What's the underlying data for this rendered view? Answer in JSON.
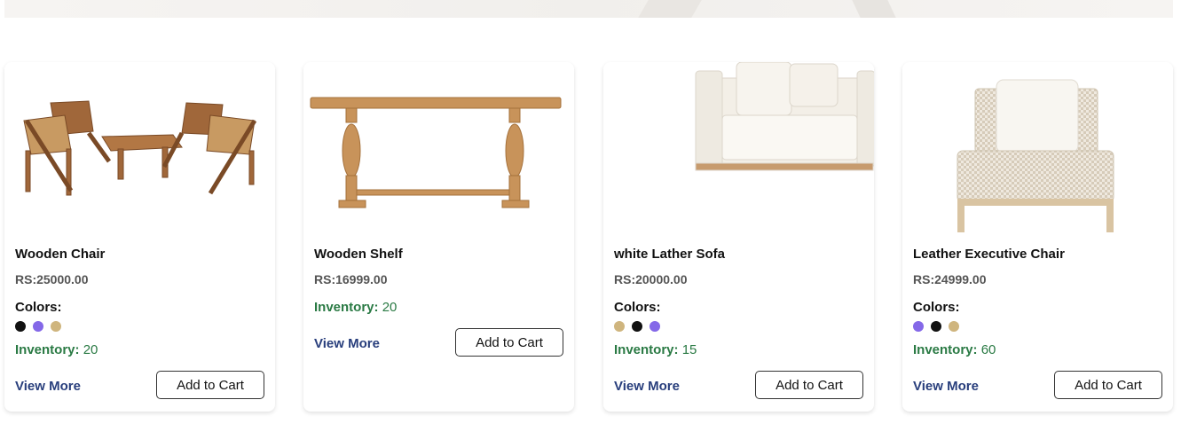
{
  "products": [
    {
      "title": "Wooden Chair",
      "price": "RS:25000.00",
      "colors_label": "Colors:",
      "colors": [
        "#111111",
        "#8468e8",
        "#cfb57e"
      ],
      "inventory_label": "Inventory:",
      "inventory": "20",
      "view_more": "View More",
      "add_to_cart": "Add to Cart"
    },
    {
      "title": "Wooden Shelf",
      "price": "RS:16999.00",
      "inventory_label": "Inventory:",
      "inventory": "20",
      "view_more": "View More",
      "add_to_cart": "Add to Cart"
    },
    {
      "title": "white Lather Sofa",
      "price": "RS:20000.00",
      "colors_label": "Colors:",
      "colors": [
        "#cfb57e",
        "#111111",
        "#8468e8"
      ],
      "inventory_label": "Inventory:",
      "inventory": "15",
      "view_more": "View More",
      "add_to_cart": "Add to Cart"
    },
    {
      "title": "Leather Executive Chair",
      "price": "RS:24999.00",
      "colors_label": "Colors:",
      "colors": [
        "#8468e8",
        "#111111",
        "#cfb57e"
      ],
      "inventory_label": "Inventory:",
      "inventory": "60",
      "view_more": "View More",
      "add_to_cart": "Add to Cart"
    }
  ]
}
